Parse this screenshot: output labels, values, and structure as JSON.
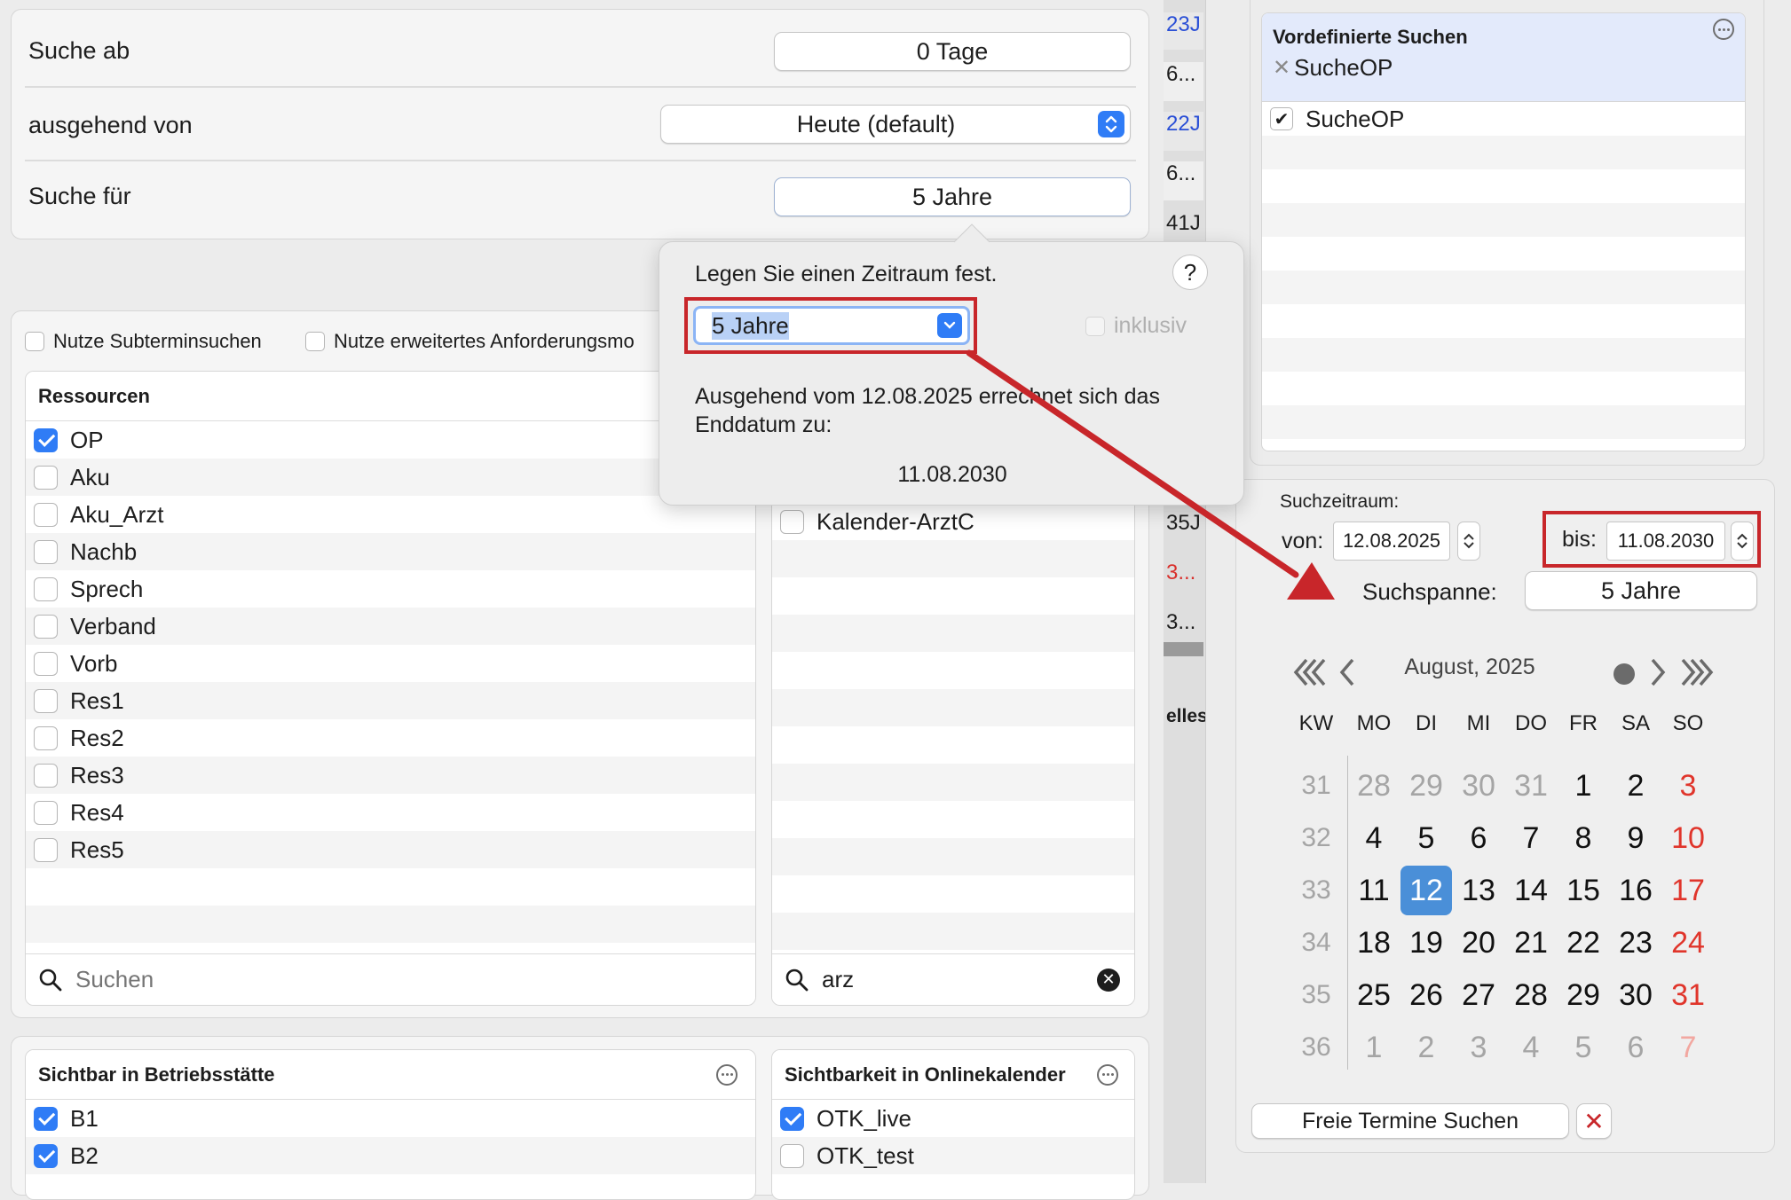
{
  "top_settings": {
    "rows": [
      {
        "label": "Suche ab",
        "value": "0 Tage"
      },
      {
        "label": "ausgehend von",
        "value": "Heute (default)"
      },
      {
        "label": "Suche für",
        "value": "5 Jahre"
      }
    ]
  },
  "options": {
    "subtermin": "Nutze Subterminsuchen",
    "anforderung": "Nutze erweitertes Anforderungsmo"
  },
  "ressourcen": {
    "header": "Ressourcen",
    "items": [
      {
        "label": "OP",
        "checked": true
      },
      {
        "label": "Aku",
        "checked": false
      },
      {
        "label": "Aku_Arzt",
        "checked": false
      },
      {
        "label": "Nachb",
        "checked": false
      },
      {
        "label": "Sprech",
        "checked": false
      },
      {
        "label": "Verband",
        "checked": false
      },
      {
        "label": "Vorb",
        "checked": false
      },
      {
        "label": "Res1",
        "checked": false
      },
      {
        "label": "Res2",
        "checked": false
      },
      {
        "label": "Res3",
        "checked": false
      },
      {
        "label": "Res4",
        "checked": false
      },
      {
        "label": "Res5",
        "checked": false
      }
    ],
    "search_placeholder": "Suchen"
  },
  "kalender": {
    "items": [
      {
        "label": "Kalender-ArztC",
        "checked": false
      }
    ],
    "search_value": "arz"
  },
  "betriebsstaette": {
    "header": "Sichtbar in Betriebsstätte",
    "items": [
      {
        "label": "B1",
        "checked": true
      },
      {
        "label": "B2",
        "checked": true
      }
    ]
  },
  "onlinekalender": {
    "header": "Sichtbarkeit in Onlinekalender",
    "items": [
      {
        "label": "OTK_live",
        "checked": true
      },
      {
        "label": "OTK_test",
        "checked": false
      }
    ]
  },
  "strip": {
    "cells": [
      {
        "text": "23J",
        "color": "#2a4fd6"
      },
      {
        "text": "6...",
        "color": "#1d1d1d"
      },
      {
        "text": "22J",
        "color": "#2a4fd6"
      },
      {
        "text": "6...",
        "color": "#1d1d1d"
      },
      {
        "text": "41J",
        "color": "#1d1d1d"
      },
      {
        "text": "35J",
        "color": "#1d1d1d"
      },
      {
        "text": "3...",
        "color": "#d9302c"
      },
      {
        "text": "3...",
        "color": "#1d1d1d"
      },
      {
        "text": "elles",
        "color": "#1d1d1d"
      }
    ]
  },
  "popover": {
    "title": "Legen Sie einen Zeitraum fest.",
    "help": "?",
    "select_value": "5 Jahre",
    "inklusiv": "inklusiv",
    "desc": "Ausgehend vom 12.08.2025 errechnet sich das Enddatum zu:",
    "result": "11.08.2030"
  },
  "vordefiniert": {
    "header": "Vordefinierte Suchen",
    "chip": "SucheOP",
    "items": [
      {
        "label": "SucheOP",
        "checked": true
      }
    ]
  },
  "suchzeitraum": {
    "label": "Suchzeitraum:",
    "von_label": "von:",
    "von_value": "12.08.2025",
    "bis_label": "bis:",
    "bis_value": "11.08.2030",
    "spanne_label": "Suchspanne:",
    "spanne_value": "5 Jahre"
  },
  "calendar": {
    "month": "August, 2025",
    "headers": [
      "KW",
      "MO",
      "DI",
      "MI",
      "DO",
      "FR",
      "SA",
      "SO"
    ],
    "weeks": [
      {
        "kw": "31",
        "days": [
          "28",
          "29",
          "30",
          "31",
          "1",
          "2",
          "3"
        ]
      },
      {
        "kw": "32",
        "days": [
          "4",
          "5",
          "6",
          "7",
          "8",
          "9",
          "10"
        ]
      },
      {
        "kw": "33",
        "days": [
          "11",
          "12",
          "13",
          "14",
          "15",
          "16",
          "17"
        ]
      },
      {
        "kw": "34",
        "days": [
          "18",
          "19",
          "20",
          "21",
          "22",
          "23",
          "24"
        ]
      },
      {
        "kw": "35",
        "days": [
          "25",
          "26",
          "27",
          "28",
          "29",
          "30",
          "31"
        ]
      },
      {
        "kw": "36",
        "days": [
          "1",
          "2",
          "3",
          "4",
          "5",
          "6",
          "7"
        ]
      }
    ],
    "selected": "12"
  },
  "actions": {
    "search": "Freie Termine Suchen",
    "cancel": "✕"
  },
  "colors": {
    "accent": "#2f7cf6",
    "highlight_red": "#c8262a",
    "weekend_red": "#e0352b",
    "selected_day": "#4a8fd8"
  }
}
